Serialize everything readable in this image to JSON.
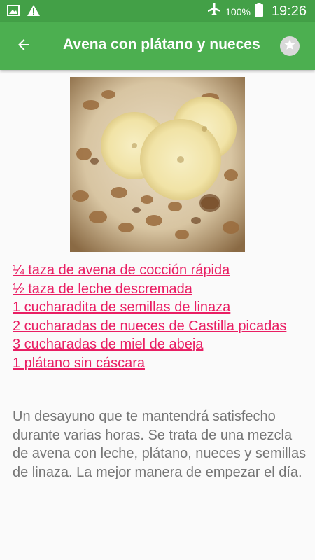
{
  "status_bar": {
    "battery_percent": "100%",
    "time": "19:26",
    "icons": [
      "gallery-icon",
      "warning-icon",
      "airplane-mode-icon",
      "battery-full-icon"
    ]
  },
  "app_bar": {
    "title": "Avena con plátano y nueces",
    "back_icon": "arrow-back-icon",
    "favorite_icon": "star-icon"
  },
  "recipe": {
    "image_alt": "oatmeal-with-banana-and-walnuts",
    "ingredients": [
      "¼ taza de avena de cocción rápida",
      "½ taza de leche descremada",
      "1 cucharadita de semillas de linaza",
      "2 cucharadas de nueces de Castilla picadas",
      "3 cucharadas de miel de abeja",
      "1 plátano sin cáscara"
    ],
    "description": "Un desayuno que te mantendrá satisfecho durante varias horas. Se trata de una mezcla de avena con leche, plátano, nueces y semillas de linaza. La mejor manera de empezar el día."
  },
  "colors": {
    "status_bar": "#43a047",
    "app_bar": "#4caf50",
    "link": "#e91e63",
    "text": "#757575"
  }
}
